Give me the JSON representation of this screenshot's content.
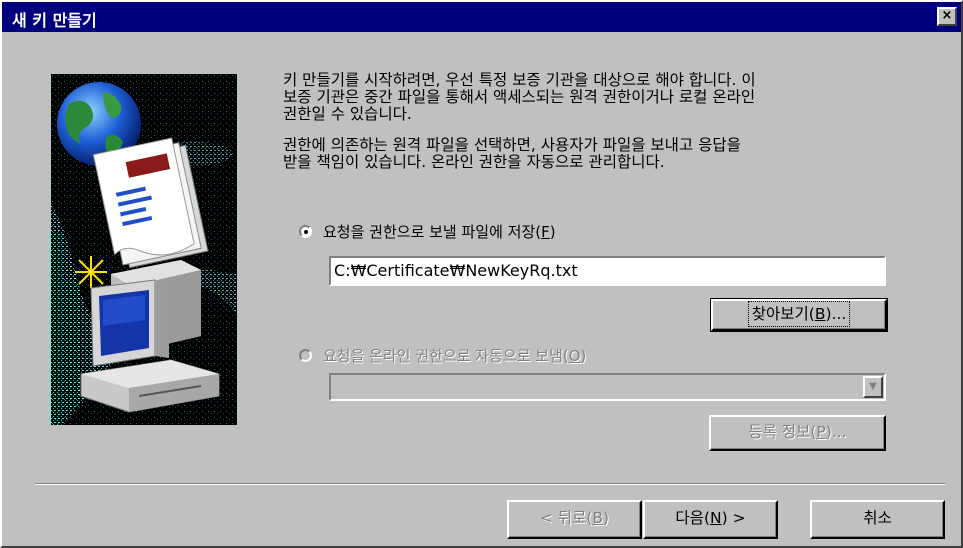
{
  "window": {
    "title": "새 키 만들기",
    "close_label": "×"
  },
  "intro": {
    "paragraph1": "키 만들기를 시작하려면, 우선 특정 보증 기관을 대상으로 해야 합니다. 이\n보증 기관은 중간 파일을 통해서 액세스되는 원격 권한이거나 로컬 온라인\n권한일 수 있습니다.",
    "paragraph2": "권한에 의존하는 원격 파일을 선택하면, 사용자가 파일을 보내고 응답을\n받을 책임이 있습니다. 온라인 권한을 자동으로 관리합니다."
  },
  "option_file": {
    "label_prefix": "요청을 권한으로 보낼 파일에 저장(",
    "label_key": "F",
    "label_suffix": ")",
    "selected": true,
    "path_value": "C:₩Certificate₩NewKeyRq.txt",
    "browse_prefix": "찾아보기(",
    "browse_key": "B",
    "browse_suffix": ")..."
  },
  "option_online": {
    "label_prefix": "요청을 온라인 권한으로 자동으로 보냄(",
    "label_key": "O",
    "label_suffix": ")",
    "selected": false,
    "disabled": true,
    "dropdown_value": "",
    "register_prefix": "등록 정보(",
    "register_key": "P",
    "register_suffix": ")..."
  },
  "footer": {
    "back_prefix": "< 뒤로(",
    "back_key": "B",
    "back_suffix": ")",
    "next_prefix": "다음(",
    "next_key": "N",
    "next_suffix": ") >",
    "cancel_label": "취소"
  },
  "art": {
    "icon": "certificate-wizard-illustration"
  }
}
